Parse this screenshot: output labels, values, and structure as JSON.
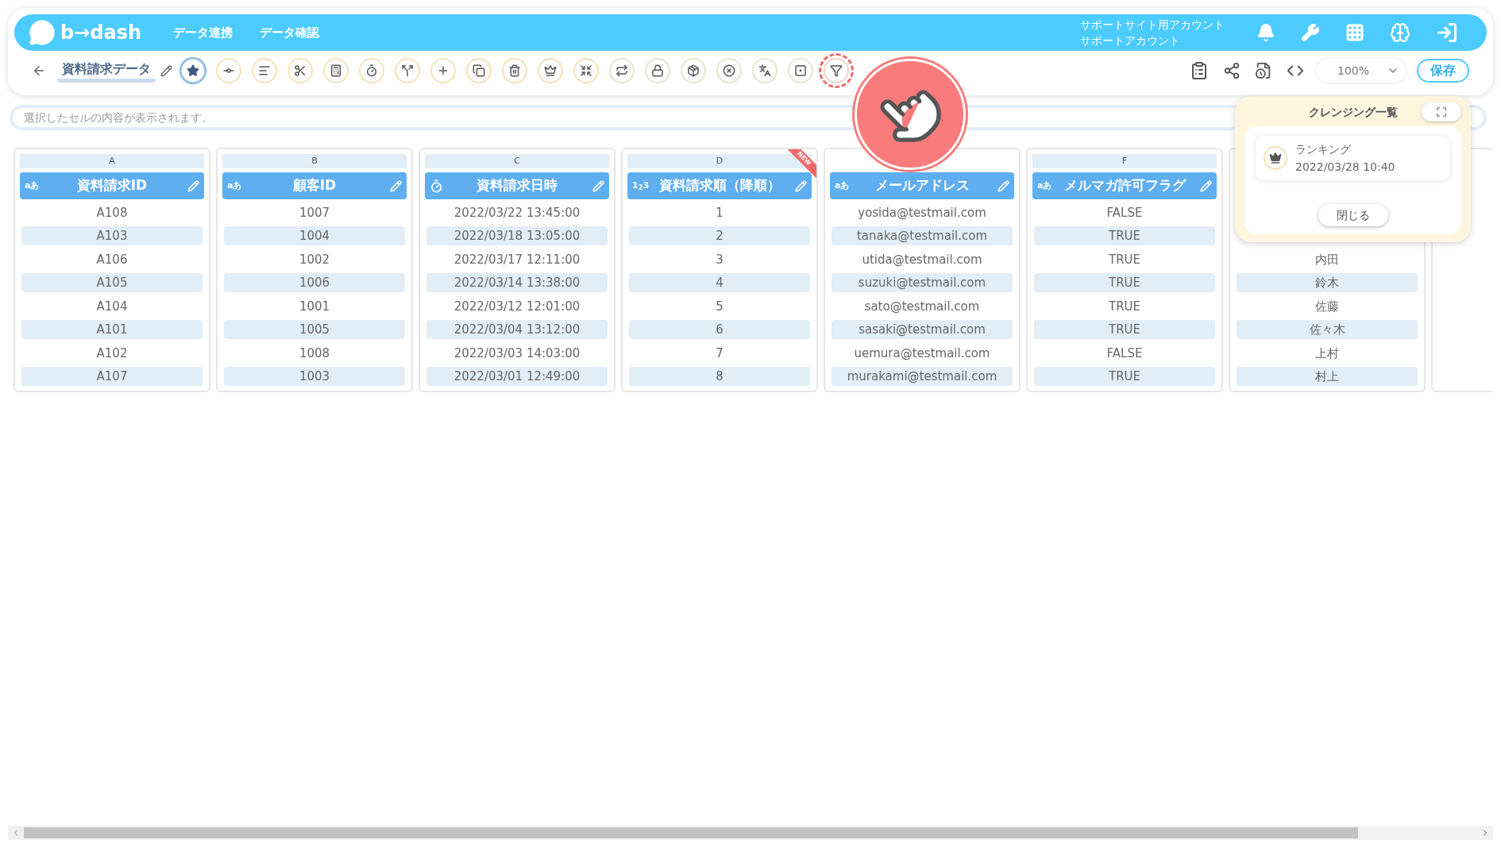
{
  "header": {
    "logo": "b→dash",
    "nav": [
      "データ連携",
      "データ確認"
    ],
    "account": [
      "サポートサイト用アカウント",
      "サポートアカウント"
    ]
  },
  "toolbar": {
    "title": "資料請求データ",
    "tools": [
      {
        "kind": "star",
        "selected": true,
        "highlighted": false,
        "color": "#a9cbe8"
      },
      {
        "kind": "join",
        "selected": false,
        "highlighted": false,
        "color": "#f3e3b5"
      },
      {
        "kind": "lines",
        "selected": false,
        "highlighted": false,
        "color": "#f3e3b5"
      },
      {
        "kind": "scissors",
        "selected": false,
        "highlighted": false,
        "color": "#f3e3b5"
      },
      {
        "kind": "calculator",
        "selected": false,
        "highlighted": false,
        "color": "#f3e3b5"
      },
      {
        "kind": "timer",
        "selected": false,
        "highlighted": false,
        "color": "#f3e3b5"
      },
      {
        "kind": "split",
        "selected": false,
        "highlighted": false,
        "color": "#f3e3b5"
      },
      {
        "kind": "plus",
        "selected": false,
        "highlighted": false,
        "color": "#f3e3b5"
      },
      {
        "kind": "copy",
        "selected": false,
        "highlighted": false,
        "color": "#f3e3b5"
      },
      {
        "kind": "trash",
        "selected": false,
        "highlighted": false,
        "color": "#f3e3b5"
      },
      {
        "kind": "crown",
        "selected": false,
        "highlighted": false,
        "color": "#f3e3b5"
      },
      {
        "kind": "shrink",
        "selected": false,
        "highlighted": false,
        "color": "#f3e3b5"
      },
      {
        "kind": "repeat",
        "selected": false,
        "highlighted": false,
        "color": "#e0e8cc"
      },
      {
        "kind": "lock",
        "selected": false,
        "highlighted": false,
        "color": "#e0e8cc"
      },
      {
        "kind": "package",
        "selected": false,
        "highlighted": false,
        "color": "#e0e8cc"
      },
      {
        "kind": "x-circle",
        "selected": false,
        "highlighted": false,
        "color": "#e0e8cc"
      },
      {
        "kind": "languages",
        "selected": false,
        "highlighted": false,
        "color": "#e0e8cc"
      },
      {
        "kind": "square",
        "selected": false,
        "highlighted": false,
        "color": "#e0e8cc"
      },
      {
        "kind": "filter",
        "selected": false,
        "highlighted": true,
        "color": "#f7d0d0"
      }
    ],
    "zoom": "100%",
    "save": "保存"
  },
  "cell_display": {
    "placeholder": "選択したセルの内容が表示されます。"
  },
  "columns": [
    {
      "letter": "A",
      "kind": "text",
      "badge": "aあ",
      "name": "資料請求ID",
      "cells": [
        "A108",
        "A103",
        "A106",
        "A105",
        "A104",
        "A101",
        "A102",
        "A107"
      ]
    },
    {
      "letter": "B",
      "kind": "text",
      "badge": "aあ",
      "name": "顧客ID",
      "cells": [
        "1007",
        "1004",
        "1002",
        "1006",
        "1001",
        "1005",
        "1008",
        "1003"
      ]
    },
    {
      "letter": "C",
      "kind": "datetime",
      "name": "資料請求日時",
      "cells": [
        "2022/03/22 13:45:00",
        "2022/03/18 13:05:00",
        "2022/03/17 12:11:00",
        "2022/03/14 13:38:00",
        "2022/03/12 12:01:00",
        "2022/03/04 13:12:00",
        "2022/03/03 14:03:00",
        "2022/03/01 12:49:00"
      ]
    },
    {
      "letter": "D",
      "kind": "number",
      "badge": "1$_{2}$3",
      "name": "資料請求順（降順）",
      "ribbon": "NEW",
      "cells": [
        "1",
        "2",
        "3",
        "4",
        "5",
        "6",
        "7",
        "8"
      ]
    },
    {
      "kind": "text",
      "badge": "aあ",
      "name": "メールアドレス",
      "cells": [
        "yosida@testmail.com",
        "tanaka@testmail.com",
        "utida@testmail.com",
        "suzuki@testmail.com",
        "sato@testmail.com",
        "sasaki@testmail.com",
        "uemura@testmail.com",
        "murakami@testmail.com"
      ]
    },
    {
      "letter": "F",
      "kind": "text",
      "badge": "aあ",
      "name": "メルマガ許可フラグ",
      "cells": [
        "FALSE",
        "TRUE",
        "TRUE",
        "TRUE",
        "TRUE",
        "TRUE",
        "FALSE",
        "TRUE"
      ]
    },
    {
      "kind": "text",
      "cells": [
        null,
        null,
        "内田",
        "鈴木",
        "佐藤",
        "佐々木",
        "上村",
        "村上"
      ]
    },
    {
      "kind": "text",
      "cells": [
        null,
        null,
        null,
        null,
        null,
        null,
        null,
        null
      ]
    }
  ],
  "cleansing_panel": {
    "title": "クレンジング一覧",
    "items": [
      {
        "name": "ランキング",
        "date": "2022/03/28 10:40"
      }
    ],
    "close": "閉じる"
  }
}
